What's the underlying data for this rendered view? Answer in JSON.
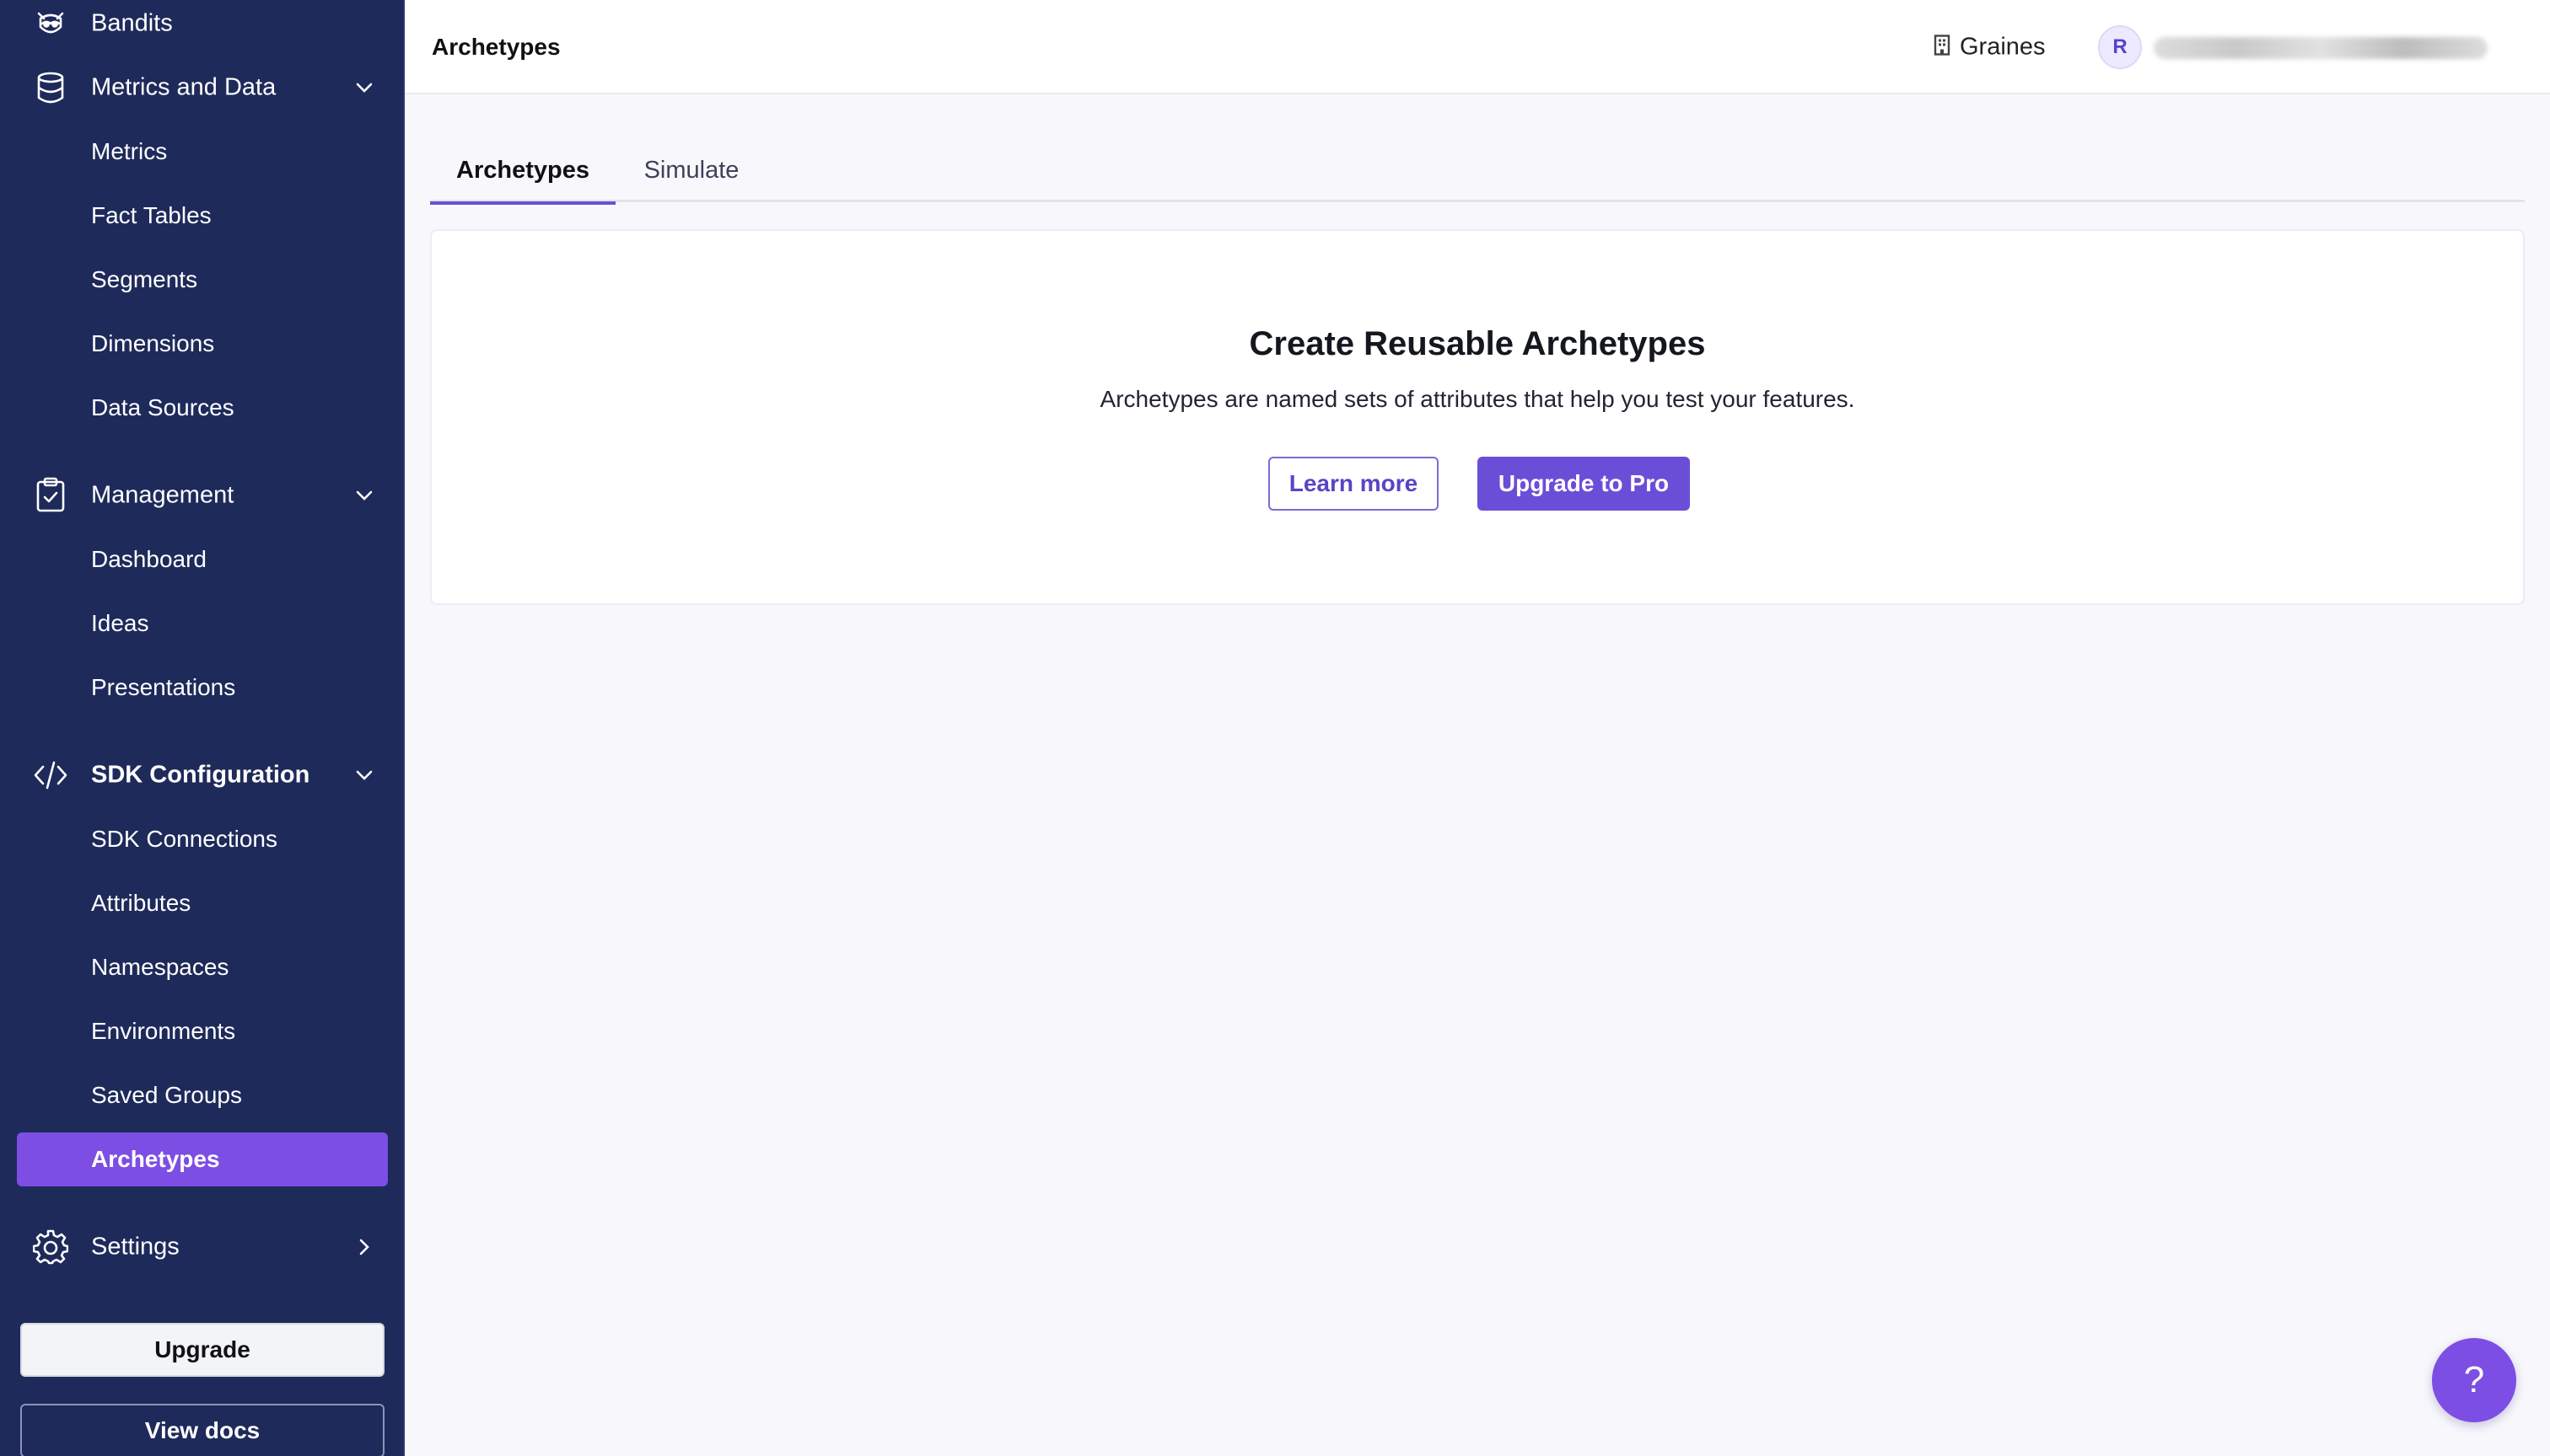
{
  "topbar": {
    "page_title": "Archetypes",
    "org_name": "Graines",
    "avatar_initial": "R"
  },
  "sidebar": {
    "groups": [
      {
        "label": "Bandits",
        "icon": "raccoon-icon"
      },
      {
        "label": "Metrics and Data",
        "icon": "database-icon",
        "expanded": true
      },
      {
        "label": "Management",
        "icon": "clipboard-check-icon",
        "expanded": true
      },
      {
        "label": "SDK Configuration",
        "icon": "code-icon",
        "expanded": true
      },
      {
        "label": "Settings",
        "icon": "gear-icon",
        "expanded": false
      }
    ],
    "items": {
      "metrics": "Metrics",
      "fact_tables": "Fact Tables",
      "segments": "Segments",
      "dimensions": "Dimensions",
      "data_sources": "Data Sources",
      "dashboard": "Dashboard",
      "ideas": "Ideas",
      "presentations": "Presentations",
      "sdk_connections": "SDK Connections",
      "attributes": "Attributes",
      "namespaces": "Namespaces",
      "environments": "Environments",
      "saved_groups": "Saved Groups",
      "archetypes": "Archetypes"
    },
    "active_item": "Archetypes",
    "upgrade_label": "Upgrade",
    "docs_label": "View docs"
  },
  "tabs": [
    {
      "label": "Archetypes",
      "active": true
    },
    {
      "label": "Simulate",
      "active": false
    }
  ],
  "empty_state": {
    "title": "Create Reusable Archetypes",
    "description": "Archetypes are named sets of attributes that help you test your features.",
    "learn_more_label": "Learn more",
    "upgrade_label": "Upgrade to Pro"
  },
  "help": {
    "label": "?"
  },
  "colors": {
    "sidebar_bg": "#1e2a5a",
    "accent": "#6b4ed8",
    "active_item": "#7c4ee4",
    "page_bg": "#f8f8fc"
  }
}
